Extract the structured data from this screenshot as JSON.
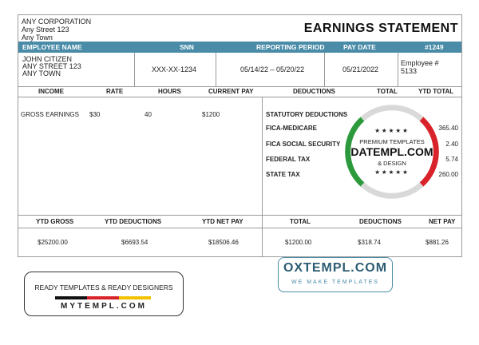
{
  "company": {
    "name": "ANY CORPORATION",
    "street": "Any Street 123",
    "town": "Any Town"
  },
  "title": "EARNINGS STATEMENT",
  "header_bar": {
    "employee_name": "EMPLOYEE NAME",
    "ssn": "SNN",
    "period": "REPORTING PERIOD",
    "pay_date": "PAY DATE",
    "number": "#1249"
  },
  "employee": {
    "name": "JOHN CITIZEN",
    "street": "ANY STREET 123",
    "town": "ANY TOWN",
    "ssn": "XXX-XX-1234",
    "period": "05/14/22 – 05/20/22",
    "pay_date": "05/21/2022",
    "emp_label": "Employee #",
    "emp_id": "5133"
  },
  "columns": {
    "income": "INCOME",
    "rate": "RATE",
    "hours": "HOURS",
    "current_pay": "CURRENT PAY",
    "deductions": "DEDUCTIONS",
    "total": "TOTAL",
    "ytd_total": "YTD TOTAL"
  },
  "earnings": [
    {
      "label": "GROSS EARNINGS",
      "rate": "$30",
      "hours": "40",
      "pay": "$1200"
    }
  ],
  "deductions": {
    "heading": "STATUTORY DEDUCTIONS",
    "items": [
      {
        "label": "FICA-MEDICARE",
        "ytd": "365.40"
      },
      {
        "label": "FICA SOCIAL SECURITY",
        "ytd": "2.40"
      },
      {
        "label": "FEDERAL TAX",
        "ytd": "5.74"
      },
      {
        "label": "STATE TAX",
        "ytd": "260.00"
      }
    ]
  },
  "footer_headers": {
    "ytd_gross": "YTD GROSS",
    "ytd_deductions": "YTD DEDUCTIONS",
    "ytd_net": "YTD NET PAY",
    "total": "TOTAL",
    "deductions": "DEDUCTIONS",
    "net_pay": "NET PAY"
  },
  "footer_values": {
    "ytd_gross": "$25200.00",
    "ytd_deductions": "$6693.54",
    "ytd_net": "$18506.46",
    "total": "$1200.00",
    "deductions": "$318.74",
    "net_pay": "$881.26"
  },
  "stamp": {
    "stars": "★★★★★",
    "line1": "PREMIUM TEMPLATES",
    "brand": "DATEMPL.COM",
    "line3": "& DESIGN",
    "stars2": "★★★★★"
  },
  "badge_left": {
    "line1": "READY TEMPLATES & READY DESIGNERS",
    "line2": "MYTEMPL.COM"
  },
  "badge_right": {
    "line1": "OXTEMPL.COM",
    "line2": "WE MAKE TEMPLATES"
  }
}
